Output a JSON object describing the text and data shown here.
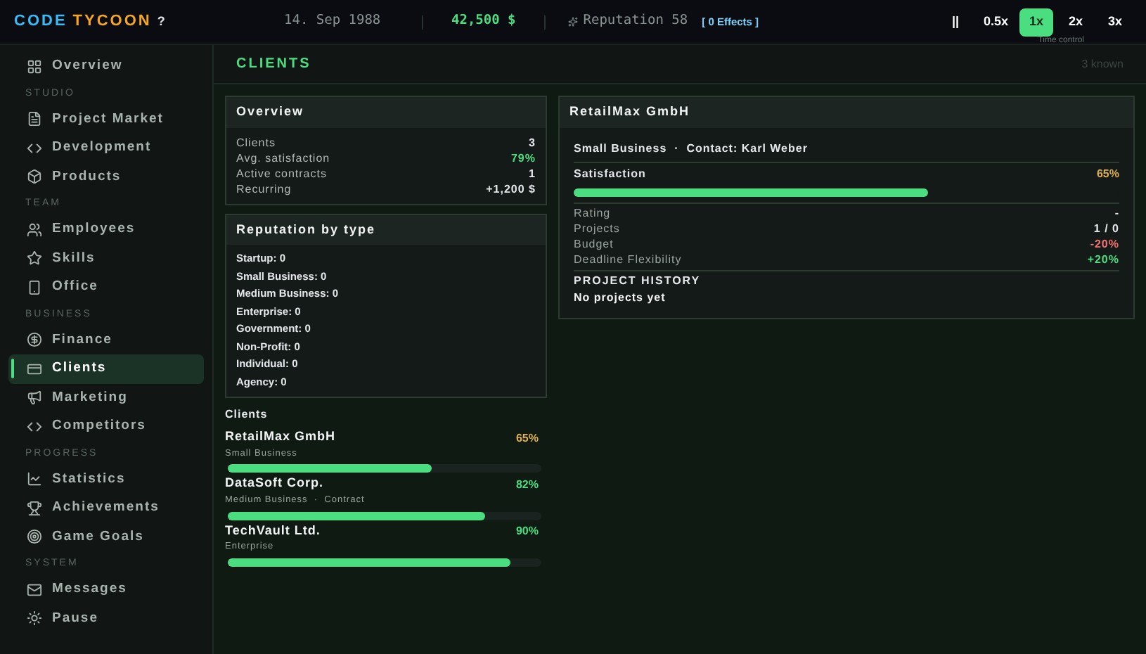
{
  "top_bar": {
    "logo_part_1": "CODE",
    "logo_part_2": "TYCOON",
    "help": "?",
    "date": "14. Sep 1988",
    "money": "42,500 $",
    "reputation": "Reputation 58",
    "effects": "[ 0 Effects ]",
    "speeds": [
      {
        "label": "||",
        "selected": false
      },
      {
        "label": "0.5x",
        "selected": false
      },
      {
        "label": "1x",
        "selected": true
      },
      {
        "label": "2x",
        "selected": false
      },
      {
        "label": "3x",
        "selected": false
      }
    ],
    "speed_caption": "Time control"
  },
  "sidebar": {
    "items": [
      {
        "kind": "item",
        "label": "Overview",
        "selected": false
      },
      {
        "kind": "section",
        "label": "STUDIO"
      },
      {
        "kind": "item",
        "label": "Project Market",
        "selected": false
      },
      {
        "kind": "item",
        "label": "Development",
        "selected": false
      },
      {
        "kind": "item",
        "label": "Products",
        "selected": false
      },
      {
        "kind": "section",
        "label": "TEAM"
      },
      {
        "kind": "item",
        "label": "Employees",
        "selected": false
      },
      {
        "kind": "item",
        "label": "Skills",
        "selected": false
      },
      {
        "kind": "item",
        "label": "Office",
        "selected": false
      },
      {
        "kind": "section",
        "label": "BUSINESS"
      },
      {
        "kind": "item",
        "label": "Finance",
        "selected": false
      },
      {
        "kind": "item",
        "label": "Clients",
        "selected": true
      },
      {
        "kind": "item",
        "label": "Marketing",
        "selected": false
      },
      {
        "kind": "item",
        "label": "Competitors",
        "selected": false
      },
      {
        "kind": "section",
        "label": "PROGRESS"
      },
      {
        "kind": "item",
        "label": "Statistics",
        "selected": false
      },
      {
        "kind": "item",
        "label": "Achievements",
        "selected": false
      },
      {
        "kind": "item",
        "label": "Game Goals",
        "selected": false
      },
      {
        "kind": "section",
        "label": "SYSTEM"
      },
      {
        "kind": "item",
        "label": "Messages",
        "selected": false
      },
      {
        "kind": "item",
        "label": "Pause",
        "selected": false
      }
    ]
  },
  "header": {
    "title": "CLIENTS",
    "count": "3 known"
  },
  "overview": {
    "title": "Overview",
    "rows": [
      {
        "label": "Clients",
        "value": "3",
        "color": "#e5e7eb"
      },
      {
        "label": "Avg. satisfaction",
        "value": "79%",
        "color": "#4ade80"
      },
      {
        "label": "Active contracts",
        "value": "1",
        "color": "#e5e7eb"
      },
      {
        "label": "Recurring",
        "value": "+1,200 $",
        "color": "#e5e7eb"
      }
    ]
  },
  "reputation": {
    "title": "Reputation by type",
    "rows": [
      "Startup: 0",
      "Small Business: 0",
      "Medium Business: 0",
      "Enterprise: 0",
      "Government: 0",
      "Non-Profit: 0",
      "Individual: 0",
      "Agency: 0"
    ]
  },
  "clients": {
    "title": "Clients",
    "items": [
      {
        "name": "RetailMax GmbH",
        "meta": "Small Business",
        "percent": "65%",
        "level": 0.65,
        "color": "#e0b050"
      },
      {
        "name": "DataSoft Corp.",
        "meta": "Medium Business  ·  Contract",
        "percent": "82%",
        "level": 0.82,
        "color": "#4ade80"
      },
      {
        "name": "TechVault Ltd.",
        "meta": "Enterprise",
        "percent": "90%",
        "level": 0.9,
        "color": "#4ade80"
      }
    ]
  },
  "detail": {
    "title": "RetailMax GmbH",
    "subtitle": "Small Business  ·  Contact: Karl Weber",
    "satisfaction_label": "Satisfaction",
    "satisfaction_value": "65%",
    "level": 0.65,
    "rows": [
      {
        "label": "Rating",
        "value": "-",
        "color": "#e5e7eb"
      },
      {
        "label": "Projects",
        "value": "1 / 0",
        "color": "#e5e7eb"
      },
      {
        "label": "Budget",
        "value": "-20%",
        "color": "#f87171"
      },
      {
        "label": "Deadline Flexibility",
        "value": "+20%",
        "color": "#4ade80"
      }
    ],
    "history_title": "PROJECT HISTORY",
    "history_empty": "No projects yet"
  }
}
